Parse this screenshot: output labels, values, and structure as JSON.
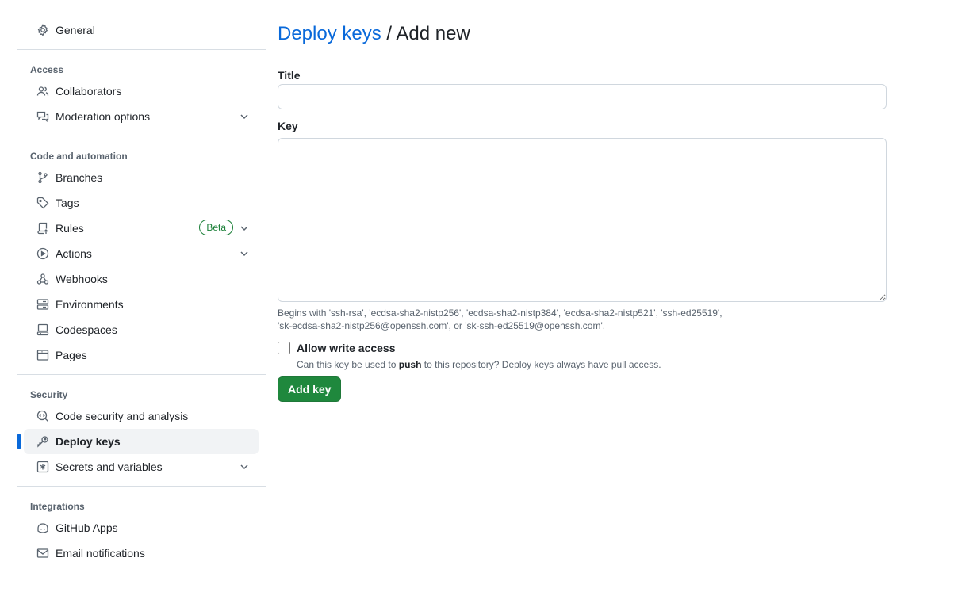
{
  "sidebar": {
    "general": {
      "label": "General",
      "icon": "gear-icon"
    },
    "access": {
      "heading": "Access",
      "items": [
        {
          "label": "Collaborators",
          "icon": "people-icon"
        },
        {
          "label": "Moderation options",
          "icon": "comment-discussion-icon",
          "expandable": true
        }
      ]
    },
    "code_automation": {
      "heading": "Code and automation",
      "items": [
        {
          "label": "Branches",
          "icon": "git-branch-icon"
        },
        {
          "label": "Tags",
          "icon": "tag-icon"
        },
        {
          "label": "Rules",
          "icon": "repo-push-icon",
          "badge": "Beta",
          "expandable": true
        },
        {
          "label": "Actions",
          "icon": "play-icon",
          "expandable": true
        },
        {
          "label": "Webhooks",
          "icon": "webhook-icon"
        },
        {
          "label": "Environments",
          "icon": "server-icon"
        },
        {
          "label": "Codespaces",
          "icon": "codespaces-icon"
        },
        {
          "label": "Pages",
          "icon": "browser-icon"
        }
      ]
    },
    "security": {
      "heading": "Security",
      "items": [
        {
          "label": "Code security and analysis",
          "icon": "codescan-icon"
        },
        {
          "label": "Deploy keys",
          "icon": "key-icon",
          "active": true
        },
        {
          "label": "Secrets and variables",
          "icon": "asterisk-icon",
          "expandable": true
        }
      ]
    },
    "integrations": {
      "heading": "Integrations",
      "items": [
        {
          "label": "GitHub Apps",
          "icon": "copilot-icon"
        },
        {
          "label": "Email notifications",
          "icon": "mail-icon"
        }
      ]
    }
  },
  "main": {
    "breadcrumb_link": "Deploy keys",
    "breadcrumb_sep": " / ",
    "breadcrumb_current": "Add new",
    "title_label": "Title",
    "title_value": "",
    "key_label": "Key",
    "key_value": "",
    "key_hint_line1": "Begins with 'ssh-rsa', 'ecdsa-sha2-nistp256', 'ecdsa-sha2-nistp384', 'ecdsa-sha2-nistp521', 'ssh-ed25519',",
    "key_hint_line2": "'sk-ecdsa-sha2-nistp256@openssh.com', or 'sk-ssh-ed25519@openssh.com'.",
    "write_access_label": "Allow write access",
    "write_access_checked": false,
    "write_hint_pre": "Can this key be used to ",
    "write_hint_bold": "push",
    "write_hint_post": " to this repository? Deploy keys always have pull access.",
    "add_button": "Add key"
  },
  "colors": {
    "link": "#0969da",
    "primary_button": "#1f883d",
    "badge": "#1a7f37",
    "active_indicator": "#0969da",
    "muted_text": "#59636e",
    "border": "#d0d7de"
  }
}
